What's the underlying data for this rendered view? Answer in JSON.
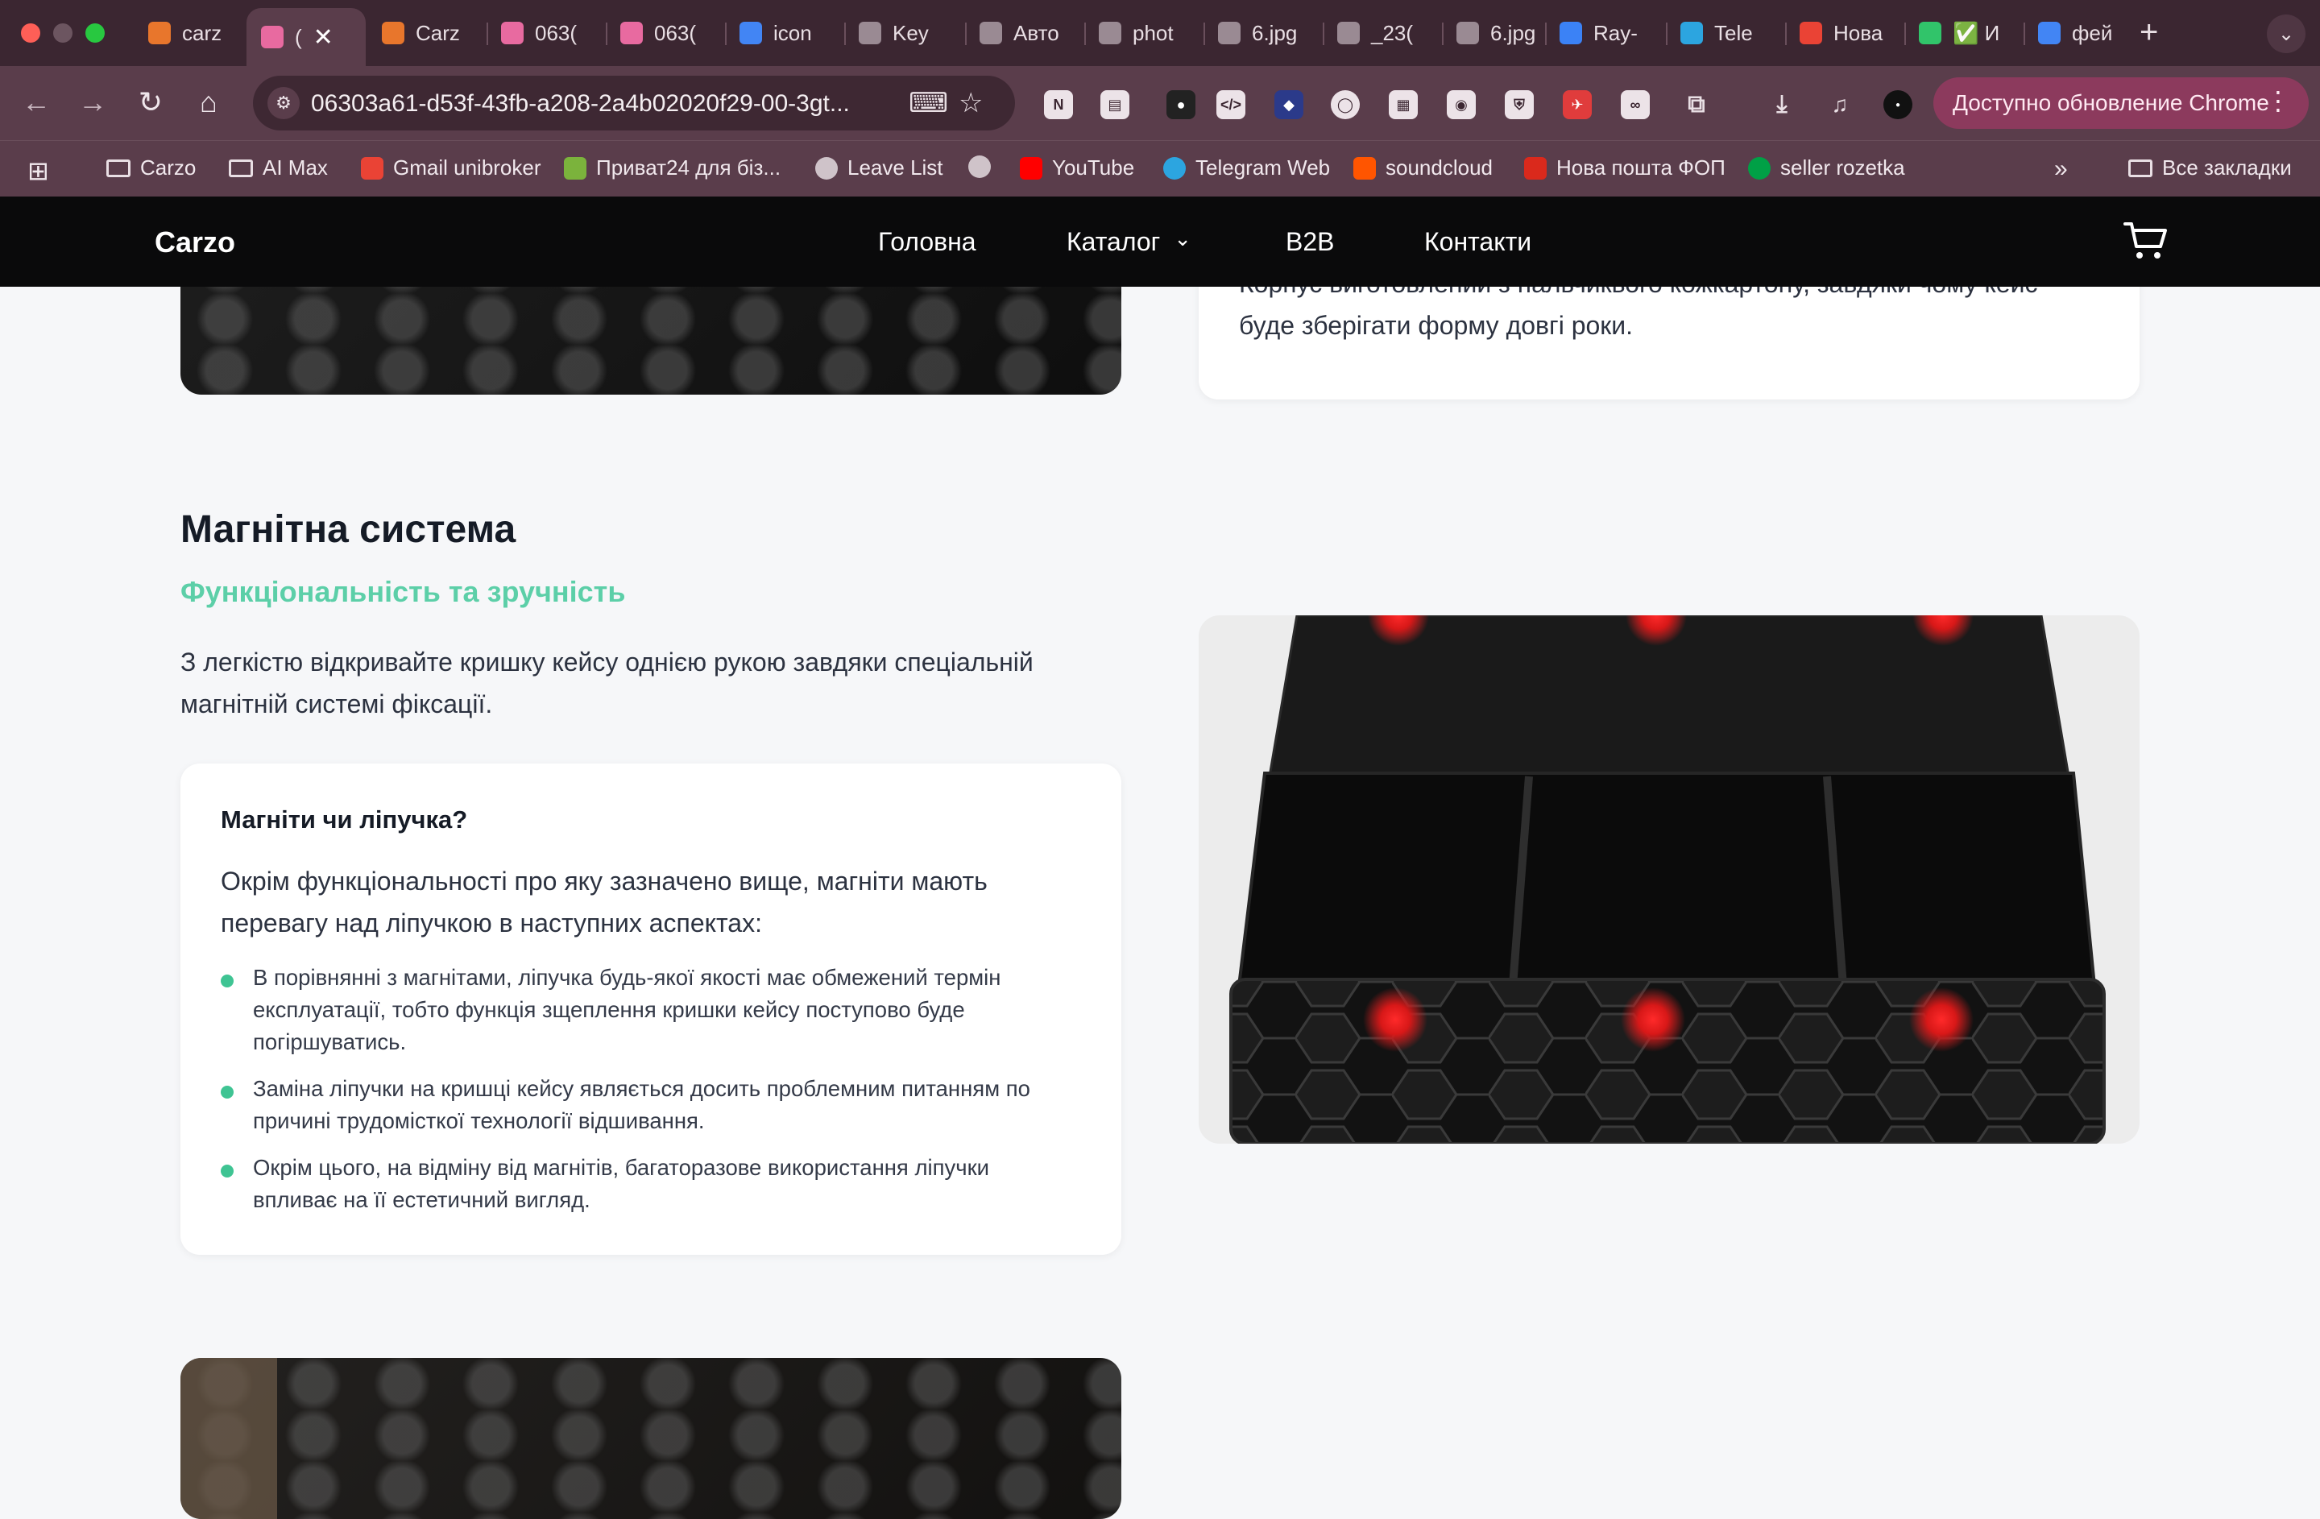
{
  "browser": {
    "tabs": [
      {
        "label": "carz",
        "icon": "carzo-favicon",
        "color": "#e8762c"
      },
      {
        "label": "(",
        "icon": "lovable-favicon",
        "color": "#e86aa0",
        "active": true
      },
      {
        "label": "Carz",
        "icon": "carzo-favicon",
        "color": "#e8762c"
      },
      {
        "label": "063(",
        "icon": "lovable-favicon",
        "color": "#e86aa0"
      },
      {
        "label": "063(",
        "icon": "lovable-favicon",
        "color": "#e86aa0"
      },
      {
        "label": "icon",
        "icon": "google-favicon",
        "color": "#4285f4"
      },
      {
        "label": "Key",
        "icon": "loading-favicon",
        "color": "#9a8a93"
      },
      {
        "label": "Авто",
        "icon": "t-favicon",
        "color": "#9a8a93"
      },
      {
        "label": "phot",
        "icon": "t-favicon",
        "color": "#9a8a93"
      },
      {
        "label": "6.jpg",
        "icon": "t-favicon",
        "color": "#9a8a93"
      },
      {
        "label": "_23(",
        "icon": "t-favicon",
        "color": "#9a8a93"
      },
      {
        "label": "6.jpg",
        "icon": "t-favicon",
        "color": "#9a8a93"
      },
      {
        "label": "Ray-",
        "icon": "meta-favicon",
        "color": "#3b82f6"
      },
      {
        "label": "Tele",
        "icon": "telegram-favicon",
        "color": "#2ca5e0"
      },
      {
        "label": "Нова",
        "icon": "gmail-favicon",
        "color": "#ea4335"
      },
      {
        "label": "✅ И",
        "icon": "check-favicon",
        "color": "#31c46a"
      },
      {
        "label": "фей",
        "icon": "google-favicon",
        "color": "#4285f4"
      }
    ],
    "close_glyph": "✕",
    "new_tab_glyph": "+",
    "url": "06303a61-d53f-43fb-a208-2a4b02020f29-00-3gt...",
    "update_button": "Доступно обновление Chrome",
    "bookmarks": [
      {
        "label": "Carzo",
        "icon": "folder"
      },
      {
        "label": "AI Max",
        "icon": "folder"
      },
      {
        "label": "Gmail unibroker",
        "icon": "gmail",
        "color": "#ea4335"
      },
      {
        "label": "Приват24 для біз...",
        "icon": "privat",
        "color": "#7bb33c"
      },
      {
        "label": "Leave List",
        "icon": "globe",
        "color": "#cfc3c9"
      },
      {
        "label": "",
        "icon": "globe",
        "color": "#cfc3c9"
      },
      {
        "label": "YouTube",
        "icon": "youtube",
        "color": "#ff0000"
      },
      {
        "label": "Telegram Web",
        "icon": "telegram",
        "color": "#2ca5e0"
      },
      {
        "label": "soundcloud",
        "icon": "soundcloud",
        "color": "#ff5500"
      },
      {
        "label": "Нова пошта ФОП",
        "icon": "novaposhta",
        "color": "#da291c"
      },
      {
        "label": "seller rozetka",
        "icon": "rozetka",
        "color": "#00a046"
      }
    ],
    "all_bookmarks": "Все закладки"
  },
  "site": {
    "logo": "Carzo",
    "nav": [
      "Головна",
      "Каталог",
      "B2B",
      "Контакти"
    ],
    "dropdown_glyph": "⌄"
  },
  "top_card": {
    "text_partial": "Корпус виготовлений з пальчиквого кожкартону, завдяки чому кейс",
    "text_last": "буде зберігати форму довгі роки."
  },
  "section": {
    "title": "Магнітна система",
    "subtitle": "Функціональність та зручність",
    "text": "З легкістю відкривайте кришку кейсу однією рукою завдяки спеціальній магнітній системі фіксації.",
    "card": {
      "title": "Магніти чи ліпучка?",
      "intro": "Окрім функціональності про яку зазначено вище, магніти мають перевагу над ліпучкою в наступних аспектах:",
      "bullets": [
        "В порівнянні з магнітами, ліпучка будь-якої якості має обмежений термін експлуатації, тобто функція зщеплення кришки кейсу поступово буде погіршуватись.",
        "Заміна ліпучки на кришці кейсу являється досить проблемним питанням по причині трудомісткої технології відшивання.",
        "Окрім цього, на відміну від магнітів, багаторазове використання ліпучки впливає на її естетичний вигляд."
      ]
    }
  },
  "colors": {
    "accent": "#5ccfa8",
    "bullet": "#3fc493",
    "magnet": "#e02020",
    "nav_bg": "#0a0a0b"
  }
}
